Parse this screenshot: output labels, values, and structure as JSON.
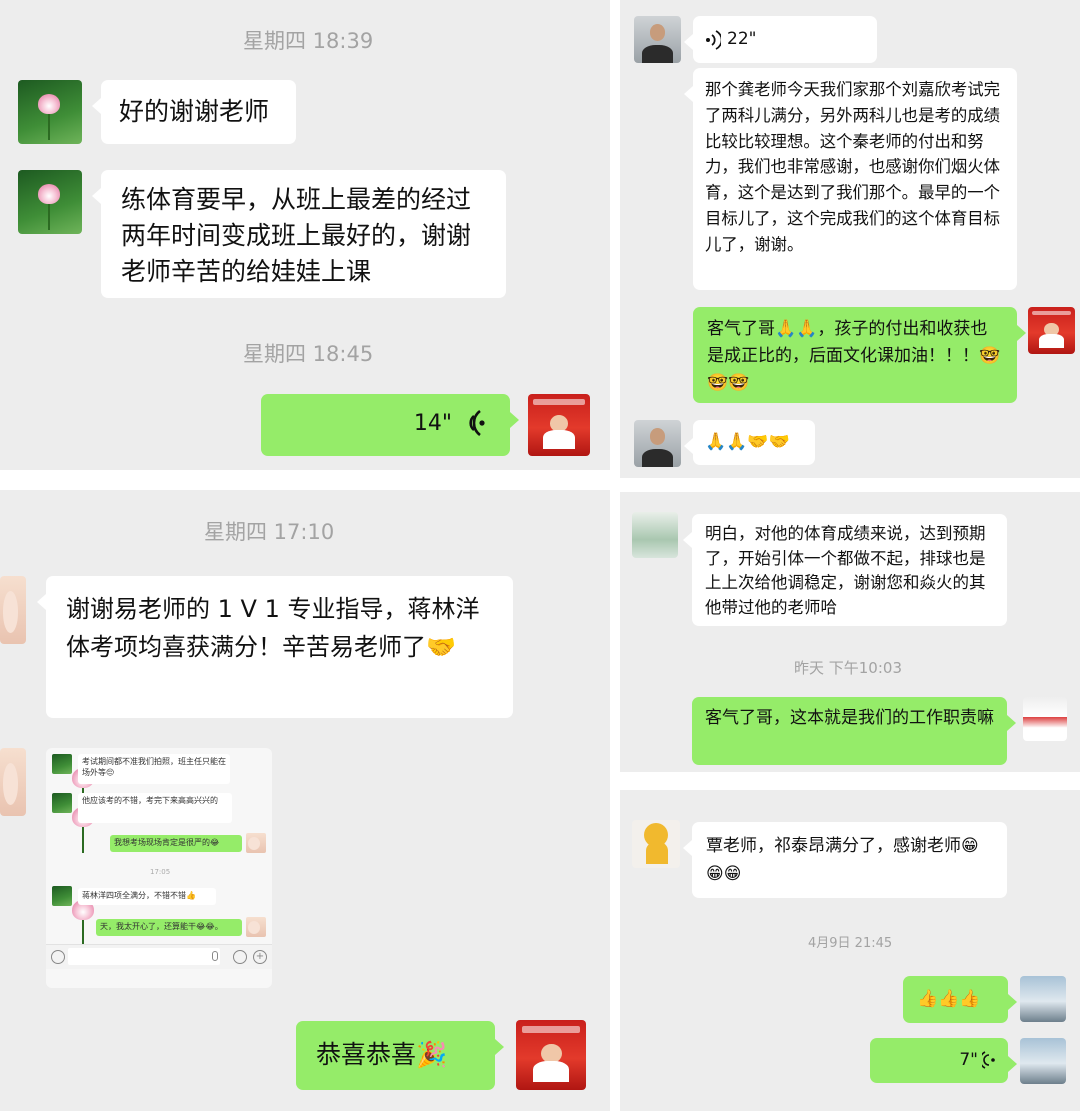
{
  "panel1": {
    "time1": "星期四 18:39",
    "msg1": "好的谢谢老师",
    "msg2": "练体育要早，从班上最差的经过两年时间变成班上最好的，谢谢老师辛苦的给娃娃上课",
    "time2": "星期四 18:45",
    "voice": "14\""
  },
  "panel2": {
    "voice": "22\"",
    "msg1": "那个龚老师今天我们家那个刘嘉欣考试完了两科儿满分，另外两科儿也是考的成绩比较比较理想。这个秦老师的付出和努力，我们也非常感谢，也感谢你们烟火体育，这个是达到了我们那个。最早的一个目标儿了，这个完成我们的这个体育目标儿了，谢谢。",
    "reply": "客气了哥🙏🙏，孩子的付出和收获也是成正比的，后面文化课加油！！！🤓🤓🤓",
    "emoji_msg": "🙏🙏🤝🤝"
  },
  "panel3": {
    "time": "星期四 17:10",
    "msg": "谢谢易老师的 1 V 1 专业指导，蒋林洋体考项均喜获满分！辛苦易老师了🤝",
    "inner": {
      "m1": "考试期间都不准我们拍照，班主任只能在场外等😔",
      "m2": "他应该考的不错，考完下来高高兴兴的",
      "m3": "我想考场现场肯定是很严的😂",
      "time": "17:05",
      "m4": "蒋林洋四项全满分，不错不错👍",
      "m5": "天，我太开心了，还算能干😂😂。"
    },
    "reply": "恭喜恭喜🎉"
  },
  "panel4": {
    "msg": "明白，对他的体育成绩来说，达到预期了，开始引体一个都做不起，排球也是上上次给他调稳定，谢谢您和焱火的其他带过他的老师哈",
    "time": "昨天 下午10:03",
    "reply": "客气了哥，这本就是我们的工作职责嘛"
  },
  "panel5": {
    "msg": "覃老师，祁泰昂满分了，感谢老师😁😁😁",
    "time": "4月9日 21:45",
    "reply": "👍👍👍",
    "voice": "7\""
  },
  "colors": {
    "background": "#ededed",
    "green_bubble": "#95ec69",
    "white_bubble": "#ffffff",
    "time_text": "#a3a3a3"
  },
  "icons": [
    "voice-wave-icon",
    "voice-message-icon",
    "emoji-icon",
    "plus-icon",
    "mic-icon"
  ]
}
